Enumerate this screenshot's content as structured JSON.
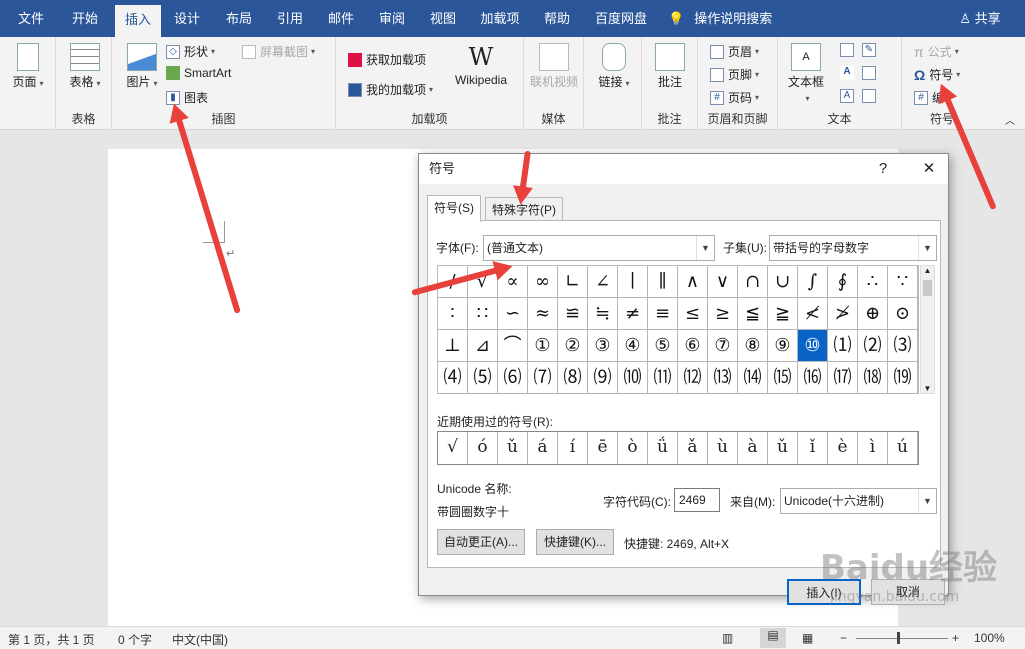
{
  "tabs": [
    "文件",
    "开始",
    "插入",
    "设计",
    "布局",
    "引用",
    "邮件",
    "审阅",
    "视图",
    "加载项",
    "帮助",
    "百度网盘"
  ],
  "tell_me": "操作说明搜索",
  "share": "共享",
  "ribbon": {
    "page": "页面",
    "table": "表格",
    "table_group": "表格",
    "picture": "图片",
    "shapes": "形状",
    "screenshot": "屏幕截图",
    "smartart": "SmartArt",
    "chart": "图表",
    "illus_group": "插图",
    "get_addins": "获取加载项",
    "my_addins": "我的加载项",
    "wikipedia": "Wikipedia",
    "addins_group": "加载项",
    "online_video": "联机视频",
    "media_group": "媒体",
    "link": "链接",
    "links_group": "",
    "comment": "批注",
    "comment_group": "批注",
    "header": "页眉",
    "footer": "页脚",
    "page_number": "页码",
    "hf_group": "页眉和页脚",
    "textbox": "文本框",
    "text_group": "文本",
    "equation": "公式",
    "symbol": "符号",
    "number": "编",
    "symbol_group": "符号"
  },
  "dialog": {
    "title": "符号",
    "help": "?",
    "close": "✕",
    "tab_symbols": "符号(S)",
    "tab_special": "特殊字符(P)",
    "font_label": "字体(F):",
    "font_value": "(普通文本)",
    "subset_label": "子集(U):",
    "subset_value": "带括号的字母数字",
    "symbols": [
      "/",
      "√",
      "∝",
      "∞",
      "∟",
      "∠",
      "∣",
      "∥",
      "∧",
      "∨",
      "∩",
      "∪",
      "∫",
      "∮",
      "∴",
      "∵",
      "∶",
      "∷",
      "∽",
      "≈",
      "≌",
      "≒",
      "≠",
      "≡",
      "≤",
      "≥",
      "≦",
      "≧",
      "≮",
      "≯",
      "⊕",
      "⊙",
      "⊥",
      "⊿",
      "⌒",
      "①",
      "②",
      "③",
      "④",
      "⑤",
      "⑥",
      "⑦",
      "⑧",
      "⑨",
      "⑩",
      "⑴",
      "⑵",
      "⑶",
      "⑷",
      "⑸",
      "⑹",
      "⑺",
      "⑻",
      "⑼",
      "⑽",
      "⑾",
      "⑿",
      "⒀",
      "⒁",
      "⒂",
      "⒃",
      "⒄",
      "⒅",
      "⒆"
    ],
    "selected_index": 44,
    "recent_label": "近期使用过的符号(R):",
    "recent": [
      "√",
      "ó",
      "ǔ",
      "á",
      "í",
      "ē",
      "ò",
      "ǘ",
      "ǎ",
      "ù",
      "à",
      "ǔ",
      "ǐ",
      "è",
      "ì",
      "ú"
    ],
    "unicode_name_label": "Unicode 名称:",
    "unicode_name": "带圆圈数字十",
    "char_code_label": "字符代码(C):",
    "char_code": "2469",
    "from_label": "来自(M):",
    "from_value": "Unicode(十六进制)",
    "autocorrect": "自动更正(A)...",
    "shortcut_btn": "快捷键(K)...",
    "shortcut_text": "快捷键: 2469, Alt+X",
    "insert": "插入(I)",
    "cancel": "取消"
  },
  "status": {
    "page": "第 1 页，共 1 页",
    "words": "0 个字",
    "lang": "中文(中国)",
    "zoom": "100%"
  },
  "watermark": "Baidu经验",
  "watermark_url": "jingyan.baidu.com",
  "accent": "#2b579a",
  "arrow_color": "#e8403a",
  "selected_color": "#0a64c8"
}
